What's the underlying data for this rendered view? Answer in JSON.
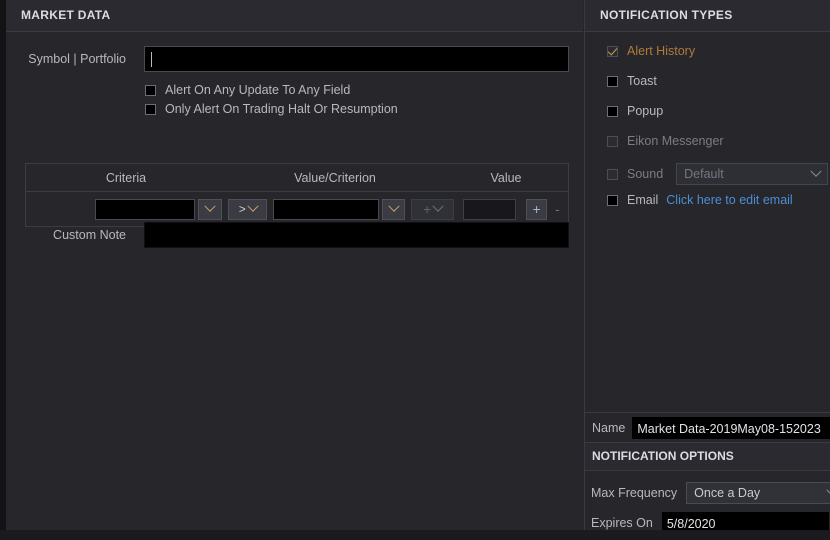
{
  "market_data": {
    "header": "MARKET DATA",
    "symbol_label": "Symbol | Portfolio",
    "symbol_value": "",
    "symbol_placeholder": "",
    "checkbox_any_update": "Alert On Any Update To Any Field",
    "checkbox_halt": "Only Alert On Trading Halt Or Resumption",
    "criteria_columns": [
      "Criteria",
      "Value/Criterion",
      "Value"
    ],
    "criteria_row": {
      "criteria_value": "",
      "operator": ">",
      "value_criterion": "",
      "extra_value": "",
      "add_label": "+",
      "remove_label": "-",
      "stack_label": "+"
    },
    "custom_note_label": "Custom Note",
    "custom_note_value": ""
  },
  "notification_types": {
    "header": "NOTIFICATION TYPES",
    "items": [
      {
        "label": "Alert History",
        "checked": true,
        "disabled": true
      },
      {
        "label": "Toast",
        "checked": false,
        "disabled": false
      },
      {
        "label": "Popup",
        "checked": false,
        "disabled": false
      },
      {
        "label": "Eikon Messenger",
        "checked": false,
        "disabled": true
      },
      {
        "label": "Sound",
        "checked": false,
        "disabled": true
      },
      {
        "label": "Email",
        "checked": false,
        "disabled": false
      }
    ],
    "sound_value": "Default",
    "email_link": "Click here to edit email"
  },
  "name_bar": {
    "label": "Name",
    "value": "Market Data-2019May08-152023"
  },
  "notification_options": {
    "header": "NOTIFICATION OPTIONS",
    "max_frequency_label": "Max Frequency",
    "max_frequency_value": "Once a Day",
    "expires_on_label": "Expires On",
    "expires_on_value": "5/8/2020"
  },
  "colors": {
    "background": "#26262b",
    "header_bar": "#2a2a30",
    "input_black": "#000000",
    "link_blue": "#4a8fd4",
    "accent_gold": "#b07b3b",
    "border": "#3a3a41"
  }
}
